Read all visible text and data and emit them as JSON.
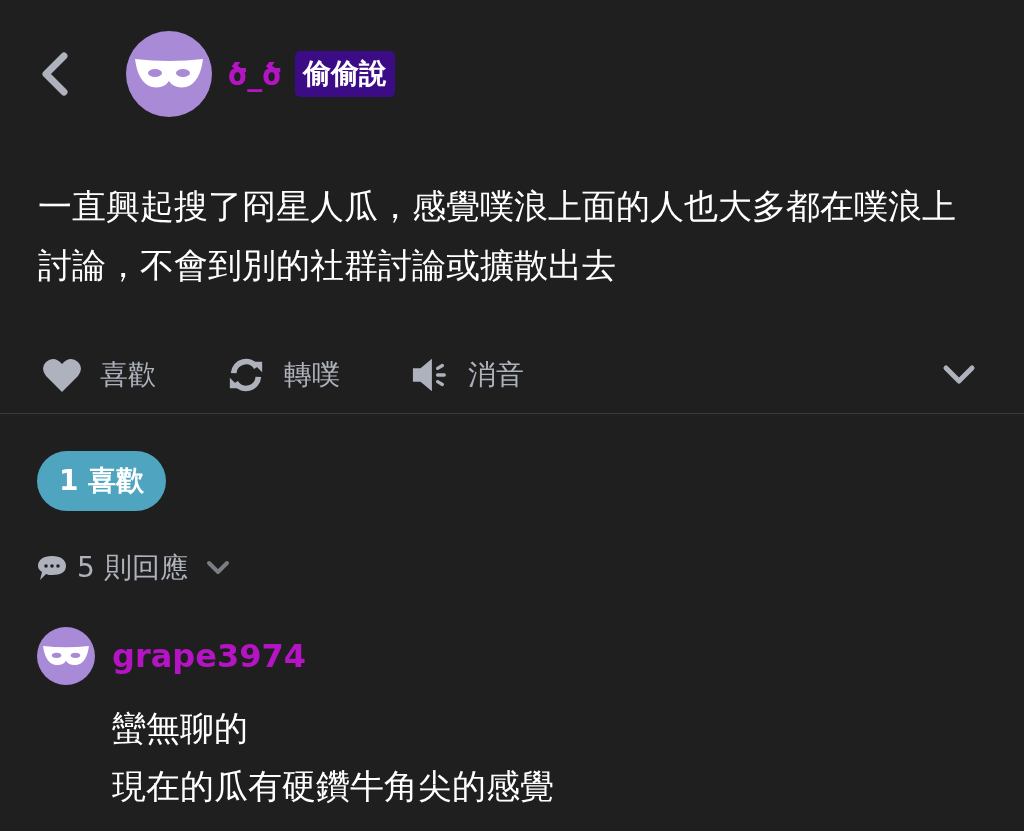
{
  "post": {
    "author": "ծ_ծ",
    "badge": "偷偷說",
    "text": "一直興起搜了冏星人瓜，感覺噗浪上面的人也大多都在噗浪上討論，不會到別的社群討論或擴散出去"
  },
  "actions": [
    {
      "kind": "like",
      "label": "喜歡"
    },
    {
      "kind": "replurk",
      "label": "轉噗"
    },
    {
      "kind": "mute",
      "label": "消音"
    }
  ],
  "likes_pill": "1 喜歡",
  "replies": {
    "label": "5 則回應",
    "expanded": false
  },
  "comments": [
    {
      "author": "grape3974",
      "lines": [
        "蠻無聊的",
        "現在的瓜有硬鑽牛角尖的感覺"
      ]
    }
  ]
}
